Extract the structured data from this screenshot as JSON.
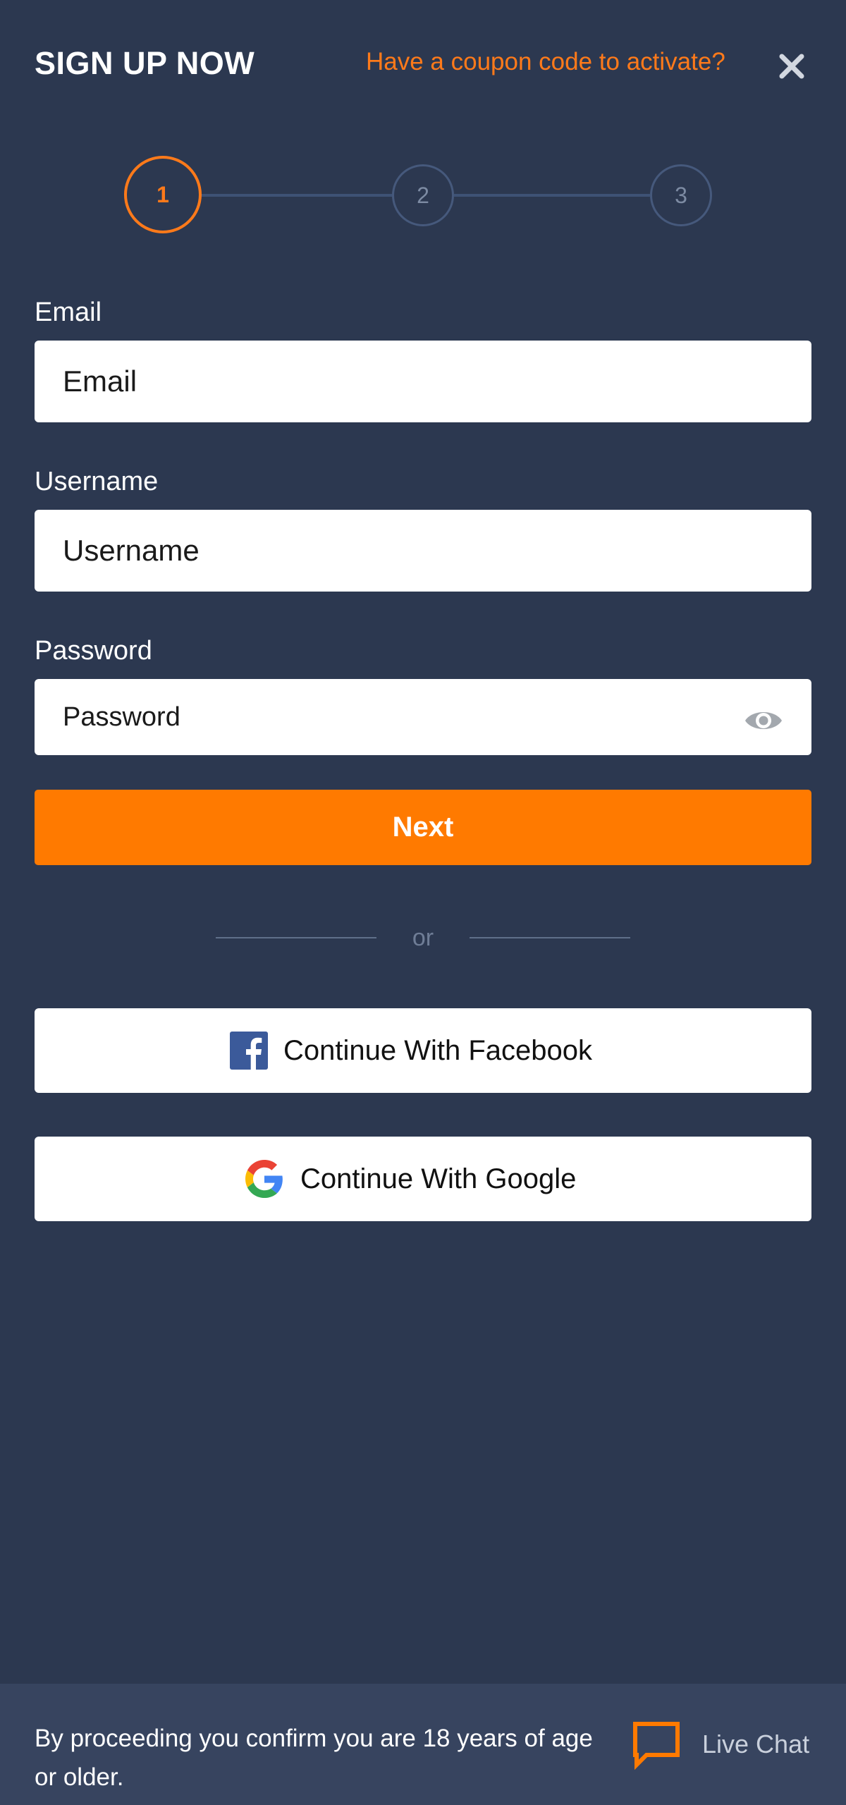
{
  "header": {
    "title": "SIGN UP NOW",
    "coupon_link": "Have a coupon code to activate?",
    "close_icon": "close-icon"
  },
  "stepper": {
    "steps": [
      "1",
      "2",
      "3"
    ],
    "active_step": 1
  },
  "form": {
    "email": {
      "label": "Email",
      "placeholder": "Email",
      "value": ""
    },
    "username": {
      "label": "Username",
      "placeholder": "Username",
      "value": ""
    },
    "password": {
      "label": "Password",
      "placeholder": "Password",
      "value": "",
      "toggle_icon": "eye-icon"
    },
    "next_label": "Next"
  },
  "divider": {
    "text": "or"
  },
  "social": {
    "facebook_label": "Continue With Facebook",
    "facebook_icon": "facebook-icon",
    "google_label": "Continue With Google",
    "google_icon": "google-icon"
  },
  "footer": {
    "disclaimer": "By proceeding you confirm you are 18 years of age or older.",
    "live_chat_label": "Live Chat",
    "live_chat_icon": "chat-bubble-icon"
  },
  "colors": {
    "background": "#2c3850",
    "footer_background": "#37445f",
    "accent": "#ff7a00",
    "step_inactive": "#46597c",
    "input_background": "#ffffff"
  }
}
